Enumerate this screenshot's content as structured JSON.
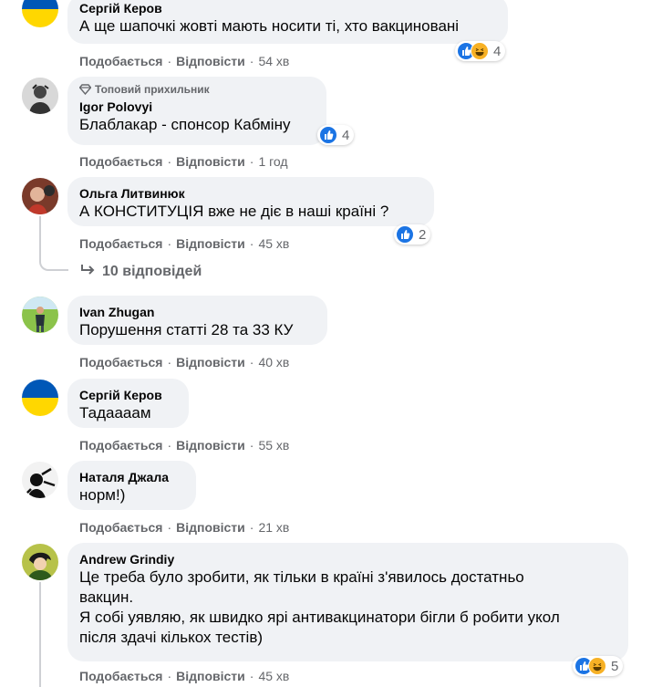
{
  "ui": {
    "like_label": "Подобається",
    "reply_label": "Відповісти",
    "separator": "·"
  },
  "comments": [
    {
      "author": "Сергій Керов",
      "text": "А ще шапочкі жовті мають носити ті, хто вакциновані",
      "time": "54 хв",
      "reactions": {
        "types": [
          "like",
          "haha"
        ],
        "count": "4"
      },
      "avatar": "ukraine-flag"
    },
    {
      "badge": "Топовий прихильник",
      "author": "Igor Polovyi",
      "text": "Блаблакар - спонсор Кабміну",
      "time": "1 год",
      "reactions": {
        "types": [
          "like"
        ],
        "count": "4"
      },
      "avatar": "person-photo"
    },
    {
      "author": "Ольга Литвинюк",
      "text": "А КОНСТИТУЦІЯ вже не діє в наші країні ?",
      "time": "45 хв",
      "reactions": {
        "types": [
          "like"
        ],
        "count": "2"
      },
      "avatar": "person-photo",
      "replies_label": "10 відповідей"
    },
    {
      "author": "Ivan Zhugan",
      "text": "Порушення статті 28 та 33 КУ",
      "time": "40 хв",
      "avatar": "person-photo"
    },
    {
      "author": "Сергій Керов",
      "text": "Тадаааам",
      "time": "55 хв",
      "avatar": "ukraine-flag"
    },
    {
      "author": "Наталя Джала",
      "text": "норм!)",
      "time": "21 хв",
      "avatar": "person-photo"
    },
    {
      "author": "Andrew Grindiy",
      "text_lines": [
        "Це треба було зробити, як тільки в країні з'явилось достатньо",
        "вакцин.",
        "Я собі уявляю, як швидко ярі антивакцинатори бігли б робити укол",
        "після здачі кількох тестів)"
      ],
      "time": "45 хв",
      "reactions": {
        "types": [
          "like",
          "haha"
        ],
        "count": "5"
      },
      "avatar": "person-photo"
    }
  ],
  "colors": {
    "bubble": "#f0f2f5",
    "meta": "#65676b",
    "like": "#1b74e4",
    "haha": "#f7b125",
    "flag_blue": "#0057b7",
    "flag_yellow": "#ffd700"
  }
}
